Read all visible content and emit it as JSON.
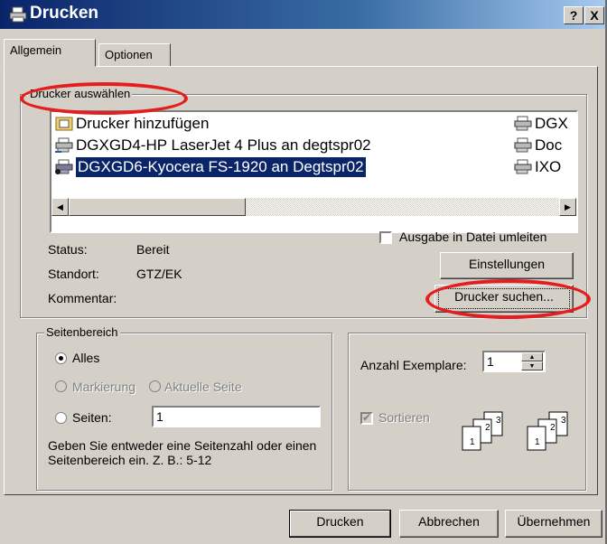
{
  "window": {
    "title": "Drucken",
    "help_button": "?",
    "close_button": "X"
  },
  "tabs": [
    {
      "label": "Allgemein",
      "active": true
    },
    {
      "label": "Optionen",
      "active": false
    }
  ],
  "printer_group": {
    "legend": "Drucker auswählen",
    "printers_left": [
      {
        "label": "Drucker hinzufügen",
        "icon": "add-printer-icon",
        "selected": false
      },
      {
        "label": "DGXGD4-HP LaserJet 4 Plus an degtspr02",
        "icon": "network-printer-icon",
        "selected": false
      },
      {
        "label": "DGXGD6-Kyocera FS-1920 an Degtspr02",
        "icon": "default-printer-icon",
        "selected": true
      }
    ],
    "printers_right": [
      {
        "label": "DGX",
        "icon": "network-printer-icon"
      },
      {
        "label": "Doc",
        "icon": "printer-icon"
      },
      {
        "label": "IXO",
        "icon": "printer-icon"
      }
    ],
    "status_label": "Status:",
    "status_value": "Bereit",
    "location_label": "Standort:",
    "location_value": "GTZ/EK",
    "comment_label": "Kommentar:",
    "print_to_file_label": "Ausgabe in Datei umleiten",
    "print_to_file_checked": false,
    "settings_button": "Einstellungen",
    "find_printer_button": "Drucker suchen..."
  },
  "page_range": {
    "legend": "Seitenbereich",
    "all_label": "Alles",
    "selection_label": "Markierung",
    "current_page_label": "Aktuelle Seite",
    "pages_label": "Seiten:",
    "pages_value": "1",
    "hint": "Geben Sie entweder eine Seitenzahl oder einen Seitenbereich ein. Z. B.: 5-12",
    "selected_option": "Alles"
  },
  "copies": {
    "label": "Anzahl Exemplare:",
    "value": "1",
    "collate_label": "Sortieren",
    "collate_checked": true
  },
  "footer": {
    "print_button": "Drucken",
    "cancel_button": "Abbrechen",
    "apply_button": "Übernehmen"
  },
  "colors": {
    "titlebar_start": "#0a246a",
    "titlebar_end": "#a6caf0",
    "selection": "#0a246a",
    "highlight_annotation": "#e41e1e",
    "dialog_face": "#d4d0c8"
  }
}
